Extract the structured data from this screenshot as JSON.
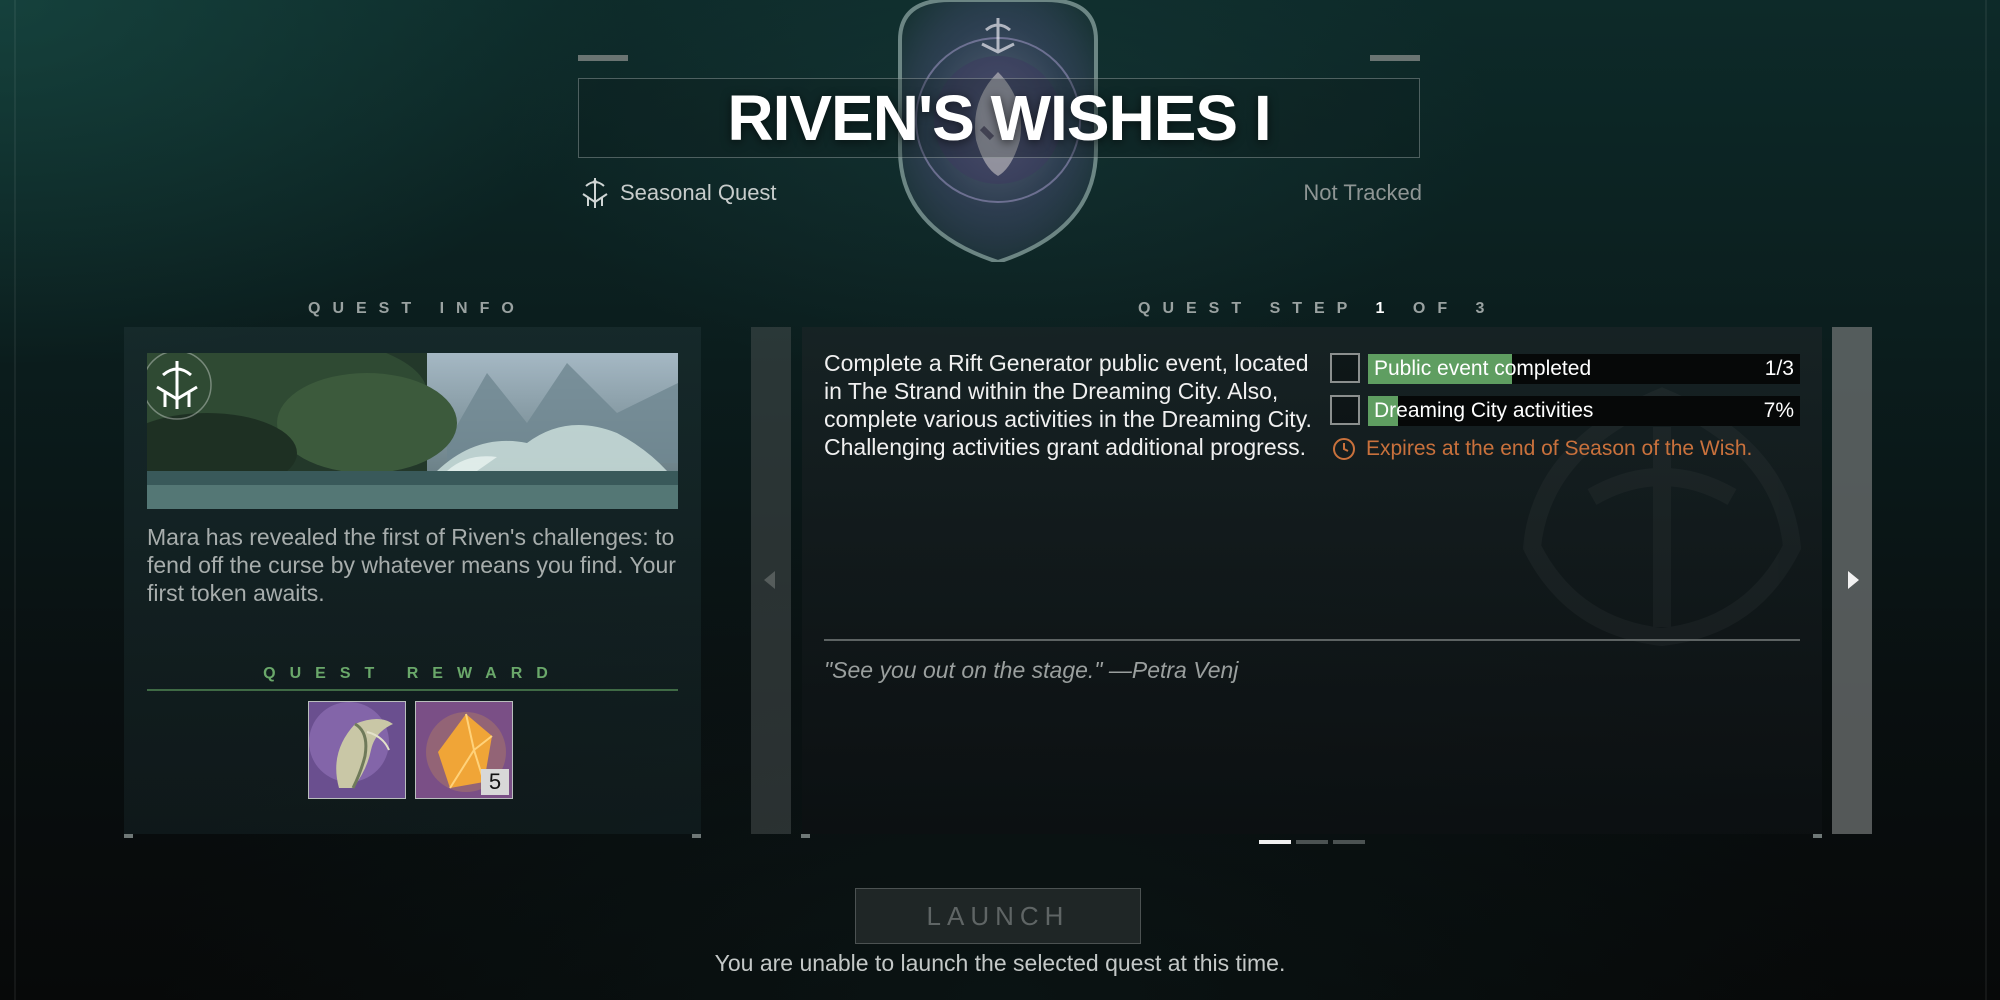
{
  "header": {
    "title": "RIVEN'S WISHES I",
    "quest_type": "Seasonal Quest",
    "quest_type_icon": "seasonal-quest-icon",
    "tracking_status": "Not Tracked"
  },
  "quest_info": {
    "section_label": "QUEST INFO",
    "description": "Mara has revealed the first of Riven's challenges: to fend off the curse by whatever means you find. Your first token awaits.",
    "reward_label": "QUEST REWARD",
    "rewards": [
      {
        "icon": "claw-engram-icon"
      },
      {
        "icon": "amber-crystal-icon",
        "count": "5"
      }
    ]
  },
  "quest_step": {
    "label_prefix": "QUEST STEP",
    "current": "1",
    "label_mid": "OF",
    "total": "3",
    "description": "Complete a Rift Generator public event, located in The Strand within the Dreaming City. Also, complete various activities in the Dreaming City. Challenging activities grant additional progress.",
    "objectives": [
      {
        "label": "Public event completed",
        "value": "1/3",
        "progress": 0.333
      },
      {
        "label": "Dreaming City activities",
        "value": "7%",
        "progress": 0.07
      }
    ],
    "expiry": "Expires at the end of Season of the Wish.",
    "quote": "\"See you out on the stage.\" —Petra Venj",
    "pages": 3,
    "active_page": 1
  },
  "launch": {
    "button_label": "LAUNCH",
    "message": "You are unable to launch the selected quest at this time."
  },
  "colors": {
    "progress_fill": "#5f9e61",
    "expiry_text": "#c9713c",
    "reward_label": "#6aa86a"
  }
}
